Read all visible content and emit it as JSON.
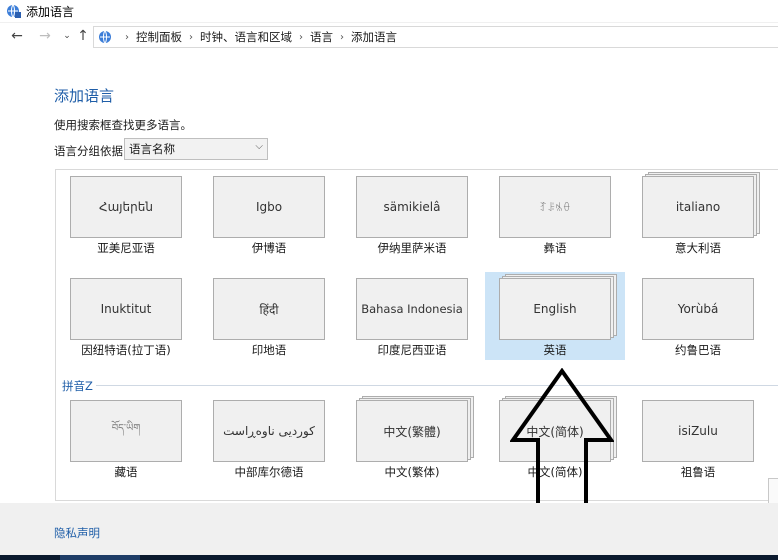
{
  "window": {
    "title": "添加语言",
    "app_icon": "language-globe-icon"
  },
  "nav": {
    "back_icon": "arrow-left-icon",
    "forward_icon": "arrow-right-icon",
    "recent_icon": "chevron-down-icon",
    "up_icon": "arrow-up-icon",
    "breadcrumb": [
      "控制面板",
      "时钟、语言和区域",
      "语言",
      "添加语言"
    ]
  },
  "main": {
    "page_title": "添加语言",
    "subtitle": "使用搜索框查找更多语言。",
    "group_by_label": "语言分组依据:",
    "group_by_value": "语言名称"
  },
  "languages": {
    "row1": [
      {
        "native": "Հայերեն",
        "name": "亚美尼亚语",
        "multi": false
      },
      {
        "native": "Igbo",
        "name": "伊博语",
        "multi": false
      },
      {
        "native": "sämikielâ",
        "name": "伊纳里萨米语",
        "multi": false
      },
      {
        "native": "ꆈꌠꁱꂷ",
        "name": "彝语",
        "multi": false
      },
      {
        "native": "italiano",
        "name": "意大利语",
        "multi": true
      }
    ],
    "row2": [
      {
        "native": "Inuktitut",
        "name": "因纽特语(拉丁语)",
        "multi": false
      },
      {
        "native": "हिंदी",
        "name": "印地语",
        "multi": false
      },
      {
        "native": "Bahasa Indonesia",
        "name": "印度尼西亚语",
        "multi": false
      },
      {
        "native": "English",
        "name": "英语",
        "multi": true,
        "selected": true
      },
      {
        "native": "Yorùbá",
        "name": "约鲁巴语",
        "multi": false
      }
    ],
    "section_header": "拼音Z",
    "row3": [
      {
        "native": "བོད་ཡིག",
        "name": "藏语",
        "multi": false
      },
      {
        "native": "کوردیی ناوەڕاست",
        "name": "中部库尔德语",
        "multi": false
      },
      {
        "native": "中文(繁體)",
        "name": "中文(繁体)",
        "multi": true
      },
      {
        "native": "中文(简体)",
        "name": "中文(简体)",
        "multi": true
      },
      {
        "native": "isiZulu",
        "name": "祖鲁语",
        "multi": false
      }
    ]
  },
  "footer": {
    "privacy_link": "隐私声明"
  },
  "annotation": {
    "type": "up-arrow-outline",
    "color": "#000000"
  },
  "colors": {
    "accent": "#1f5ea8",
    "selection": "#cce4f7"
  }
}
